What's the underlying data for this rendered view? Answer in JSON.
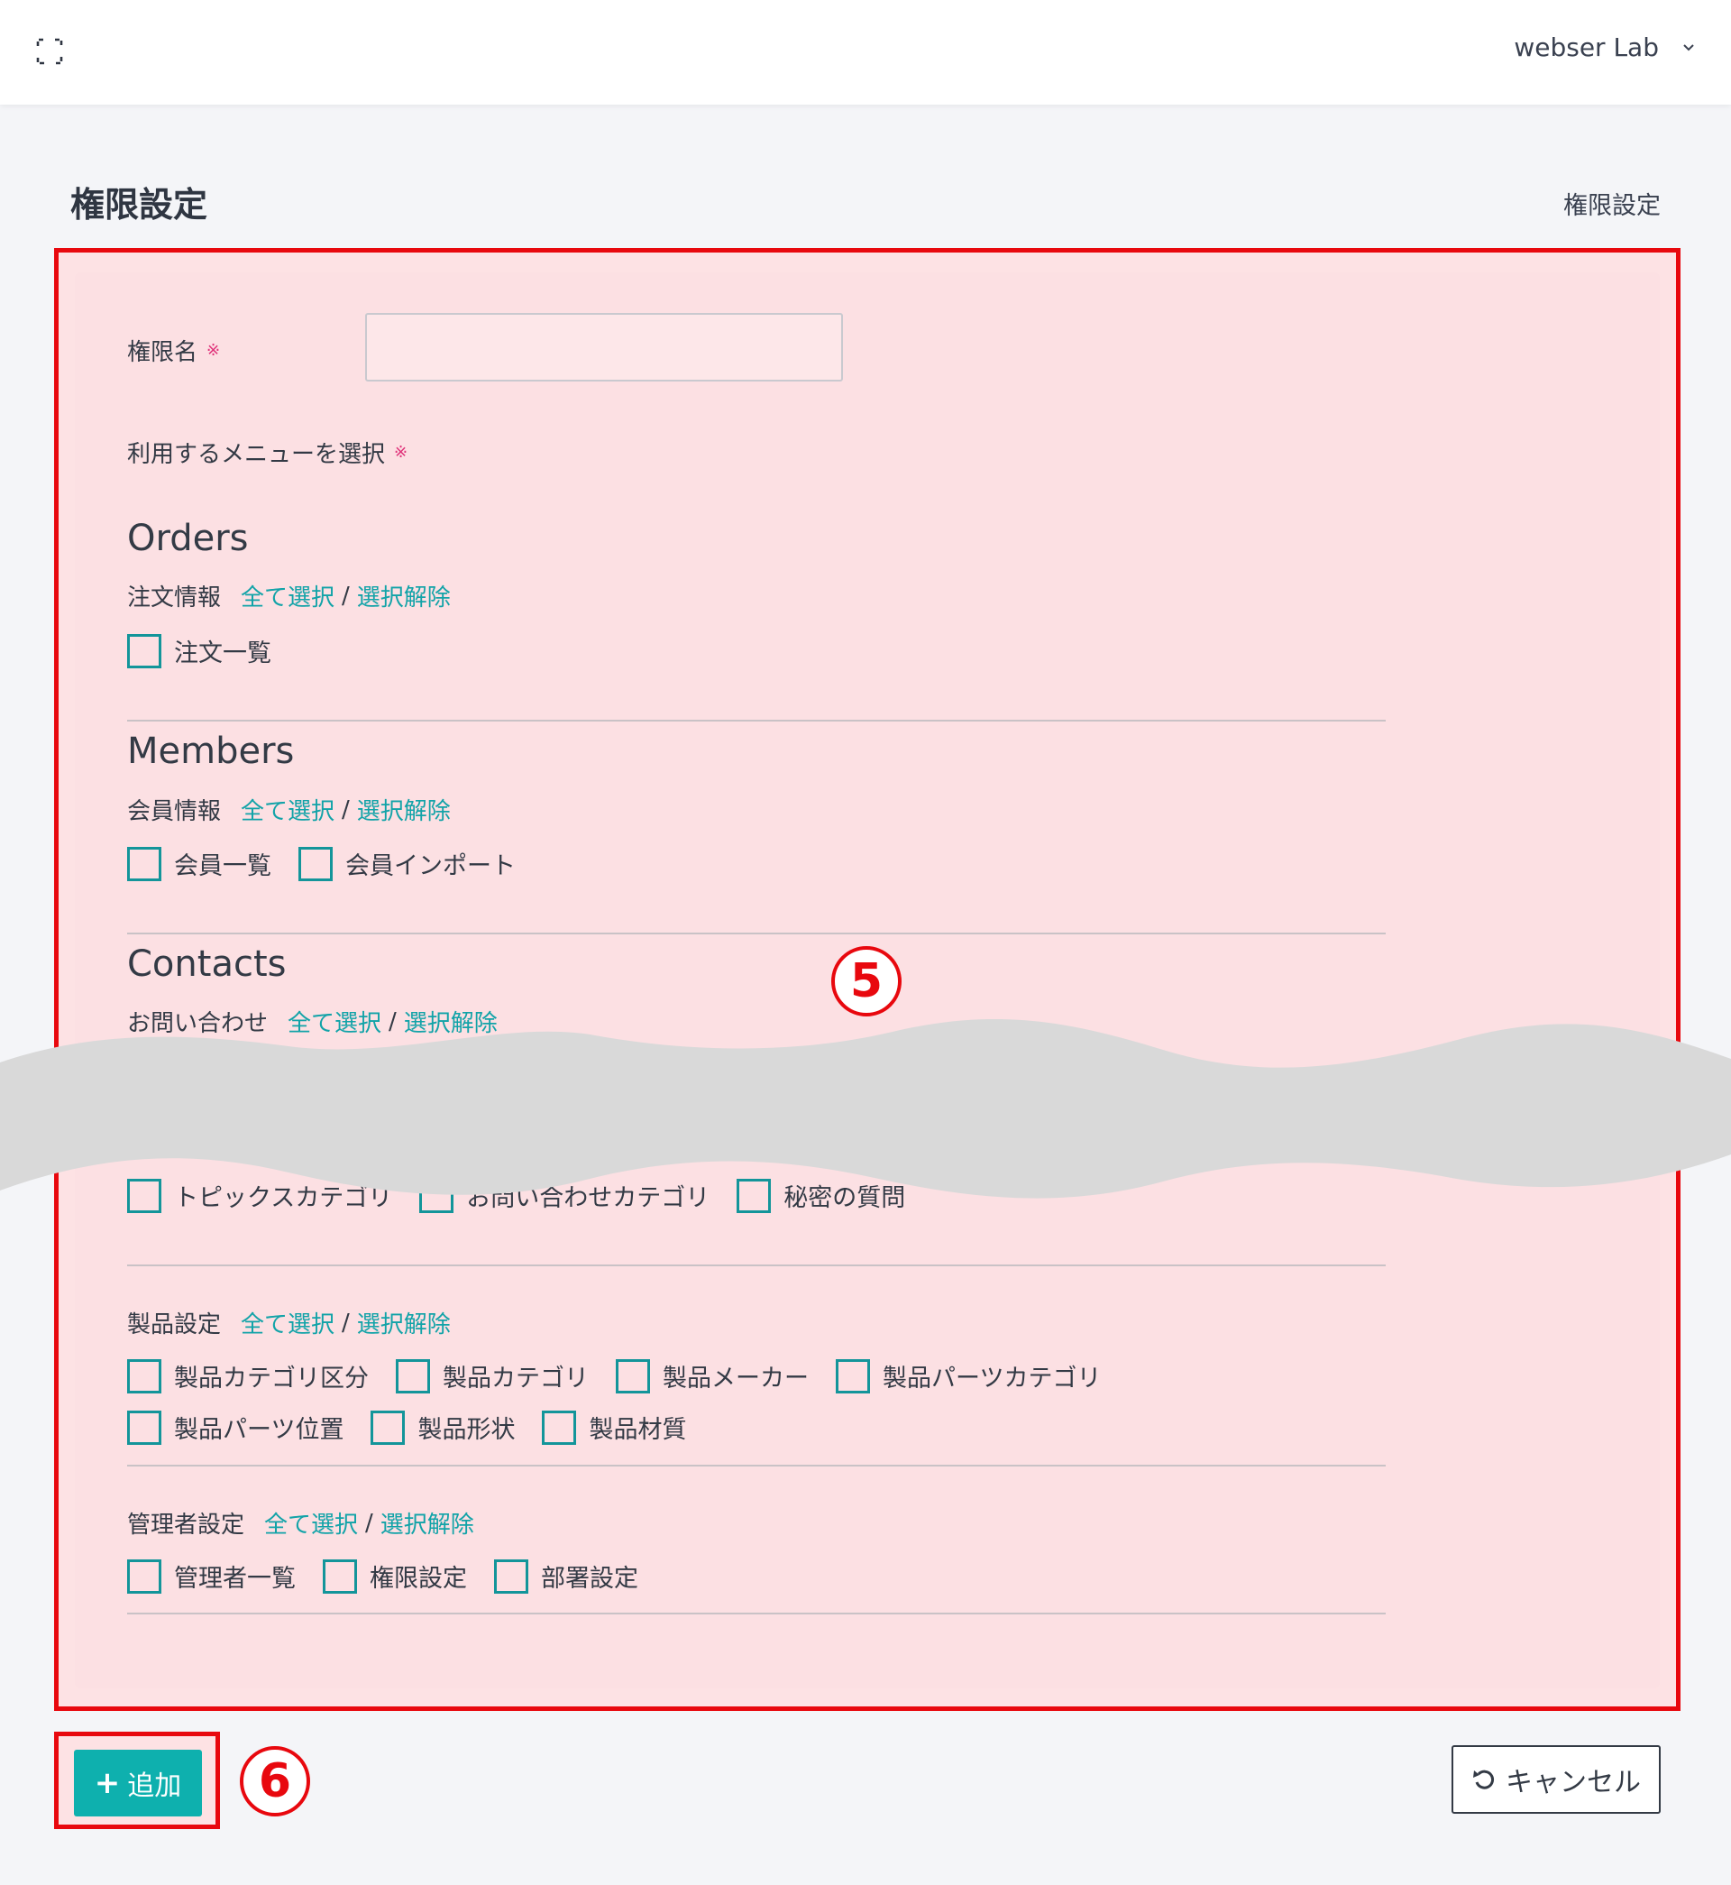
{
  "header": {
    "user_name": "webser Lab"
  },
  "page": {
    "title": "権限設定",
    "breadcrumb": "権限設定"
  },
  "form": {
    "name_label": "権限名",
    "required_mark": "※",
    "name_value": "",
    "menu_label": "利用するメニューを選択",
    "select_all": "全て選択",
    "separator": "/",
    "deselect_all": "選択解除",
    "sections": [
      {
        "title": "Orders",
        "groups": [
          {
            "name": "注文情報",
            "items": [
              "注文一覧"
            ]
          }
        ]
      },
      {
        "title": "Members",
        "groups": [
          {
            "name": "会員情報",
            "items": [
              "会員一覧",
              "会員インポート"
            ]
          }
        ]
      },
      {
        "title": "Contacts",
        "groups": [
          {
            "name": "お問い合わせ",
            "items": []
          }
        ]
      }
    ],
    "partial_items": [
      "トピックスカテゴリ",
      "お問い合わせカテゴリ",
      "秘密の質問"
    ],
    "product_group": {
      "name": "製品設定",
      "items_row1": [
        "製品カテゴリ区分",
        "製品カテゴリ",
        "製品メーカー",
        "製品パーツカテゴリ"
      ],
      "items_row2": [
        "製品パーツ位置",
        "製品形状",
        "製品材質"
      ]
    },
    "admin_group": {
      "name": "管理者設定",
      "items": [
        "管理者一覧",
        "権限設定",
        "部署設定"
      ]
    }
  },
  "annotations": {
    "form_marker": "5",
    "add_marker": "6"
  },
  "actions": {
    "add_label": "追加",
    "cancel_label": "キャンセル"
  },
  "colors": {
    "accent": "#0eb0ae",
    "link": "#12a3a8",
    "highlight_border": "#e8080e",
    "highlight_fill": "#fde2e4",
    "torn_overlay": "#d9d9d9"
  },
  "icons": {
    "expand": "fullscreen-icon",
    "user_dropdown": "chevron-down-icon",
    "add": "plus-icon",
    "cancel": "undo-icon"
  }
}
